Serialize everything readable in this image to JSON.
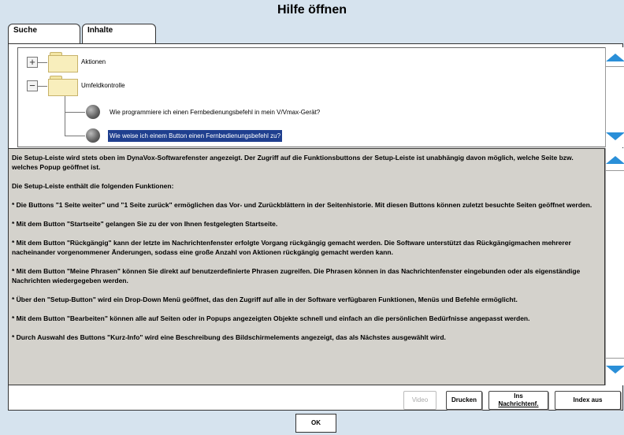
{
  "window": {
    "title": "Hilfe öffnen"
  },
  "tabs": [
    {
      "label": "Suche",
      "active": true
    },
    {
      "label": "Inhalte",
      "active": false
    }
  ],
  "tree": {
    "groups": [
      {
        "label": "Aktionen",
        "toggle": "+"
      },
      {
        "label": "Umfeldkontrolle",
        "toggle": "−"
      }
    ],
    "items": [
      {
        "label": "Wie programmiere ich einen Fernbedienungsbefehl in mein V/Vmax-Gerät?",
        "selected": false
      },
      {
        "label": "Wie weise ich einem Button einen Fernbedienungsbefehl zu?",
        "selected": true
      }
    ]
  },
  "content": {
    "paragraphs": [
      "Die Setup-Leiste wird stets oben im DynaVox-Softwarefenster angezeigt. Der Zugriff auf die Funktionsbuttons der Setup-Leiste ist unabhängig davon möglich, welche Seite bzw. welches Popup geöffnet ist.",
      "Die Setup-Leiste enthält die folgenden Funktionen:",
      "* Die Buttons \"1 Seite weiter\" und \"1 Seite zurück\" ermöglichen das Vor- und Zurückblättern in der Seitenhistorie. Mit diesen Buttons können zuletzt besuchte Seiten geöffnet werden.",
      "* Mit dem Button \"Startseite\" gelangen Sie zu der von Ihnen festgelegten Startseite.",
      "* Mit dem Button \"Rückgängig\" kann der letzte im Nachrichtenfenster erfolgte Vorgang rückgängig gemacht werden. Die Software unterstützt das Rückgängigmachen mehrerer nacheinander vorgenommener Änderungen, sodass eine große Anzahl von Aktionen rückgängig gemacht werden kann.",
      "* Mit dem Button \"Meine Phrasen\" können Sie direkt auf benutzerdefinierte Phrasen zugreifen. Die Phrasen können in das Nachrichtenfenster eingebunden oder als eigenständige Nachrichten wiedergegeben werden.",
      "* Über den \"Setup-Button\" wird ein Drop-Down Menü geöffnet, das den Zugriff auf alle in der Software verfügbaren Funktionen, Menüs und Befehle ermöglicht.",
      "* Mit dem Button \"Bearbeiten\" können alle auf Seiten oder in Popups angezeigten Objekte schnell und einfach an die persönlichen Bedürfnisse angepasst werden.",
      "* Durch Auswahl des Buttons \"Kurz-Info\" wird eine Beschreibung des Bildschirmelements angezeigt, das als Nächstes ausgewählt wird."
    ]
  },
  "buttons": {
    "video": "Video",
    "print": "Drucken",
    "to_message_line1": "Ins",
    "to_message_line2": "Nachrichtenf.",
    "index": "Index aus",
    "ok": "OK"
  },
  "colors": {
    "accent": "#2a8fd8",
    "selection": "#1f3f8f",
    "content_bg": "#d4d2cc"
  }
}
